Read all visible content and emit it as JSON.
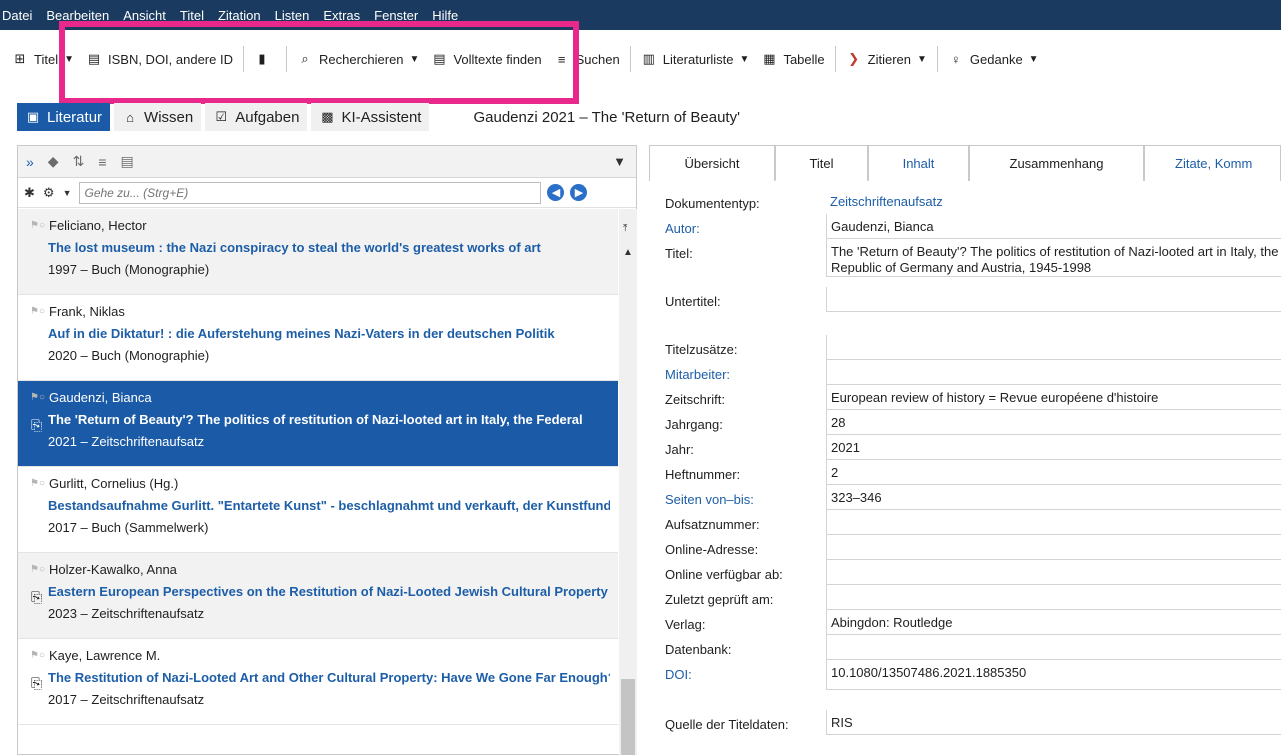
{
  "menu": [
    "Datei",
    "Bearbeiten",
    "Ansicht",
    "Titel",
    "Zitation",
    "Listen",
    "Extras",
    "Fenster",
    "Hilfe"
  ],
  "toolbar": {
    "titel": "Titel",
    "isbn": "ISBN, DOI, andere ID",
    "recherchieren": "Recherchieren",
    "volltexte": "Volltexte finden",
    "suchen": "Suchen",
    "literaturliste": "Literaturliste",
    "tabelle": "Tabelle",
    "zitieren": "Zitieren",
    "gedanke": "Gedanke"
  },
  "sections": {
    "literatur": "Literatur",
    "wissen": "Wissen",
    "aufgaben": "Aufgaben",
    "ki": "KI-Assistent"
  },
  "record_title": "Gaudenzi 2021 – The 'Return of Beauty'",
  "search": {
    "placeholder": "Gehe zu... (Strg+E)"
  },
  "list": [
    {
      "author": "Feliciano, Hector",
      "title": "The lost museum : the Nazi conspiracy to steal the world's greatest works of art",
      "meta": "1997 – Buch (Monographie)",
      "attachment": false
    },
    {
      "author": "Frank, Niklas",
      "title": "Auf in die Diktatur! : die Auferstehung meines Nazi-Vaters in der deutschen Politik",
      "meta": "2020 – Buch (Monographie)",
      "attachment": false
    },
    {
      "author": "Gaudenzi, Bianca",
      "title": "The 'Return of Beauty'? The politics of restitution of Nazi-looted art in Italy, the Federal",
      "meta": "2021 – Zeitschriftenaufsatz",
      "attachment": true
    },
    {
      "author": "Gurlitt, Cornelius (Hg.)",
      "title": "Bestandsaufnahme Gurlitt. \"Entartete Kunst\" - beschlagnahmt und verkauft, der Kunstfund",
      "meta": "2017 – Buch (Sammelwerk)",
      "attachment": false
    },
    {
      "author": "Holzer-Kawalko, Anna",
      "title": "Eastern European Perspectives on the Restitution of Nazi-Looted Jewish Cultural Property",
      "meta": "2023 – Zeitschriftenaufsatz",
      "attachment": true
    },
    {
      "author": "Kaye, Lawrence M.",
      "title": "The Restitution of Nazi-Looted Art and Other Cultural Property: Have We Gone Far Enough?",
      "meta": "2017 – Zeitschriftenaufsatz",
      "attachment": true
    }
  ],
  "tabs": [
    "Übersicht",
    "Titel",
    "Inhalt",
    "Zusammenhang",
    "Zitate, Komm"
  ],
  "fields": {
    "dokumententyp_label": "Dokumententyp:",
    "dokumententyp": "Zeitschriftenaufsatz",
    "autor_label": "Autor:",
    "autor": "Gaudenzi, Bianca",
    "titel_label": "Titel:",
    "titel_line1": "The 'Return of Beauty'? The politics of restitution of Nazi-looted art in Italy, the Federal",
    "titel_line2": "Republic of Germany and Austria, 1945-1998",
    "untertitel_label": "Untertitel:",
    "titelzusaetze_label": "Titelzusätze:",
    "mitarbeiter_label": "Mitarbeiter:",
    "zeitschrift_label": "Zeitschrift:",
    "zeitschrift": "European review of history = Revue européene d'histoire",
    "jahrgang_label": "Jahrgang:",
    "jahrgang": "28",
    "jahr_label": "Jahr:",
    "jahr": "2021",
    "heftnummer_label": "Heftnummer:",
    "heftnummer": "2",
    "seiten_label": "Seiten von–bis:",
    "seiten": "323–346",
    "aufsatznummer_label": "Aufsatznummer:",
    "online_adresse_label": "Online-Adresse:",
    "online_ab_label": "Online verfügbar ab:",
    "geprueft_label": "Zuletzt geprüft am:",
    "verlag_label": "Verlag:",
    "verlag": "Abingdon: Routledge",
    "datenbank_label": "Datenbank:",
    "doi_label": "DOI:",
    "doi": "10.1080/13507486.2021.1885350",
    "quelle_label": "Quelle der Titeldaten:",
    "quelle": "RIS"
  }
}
